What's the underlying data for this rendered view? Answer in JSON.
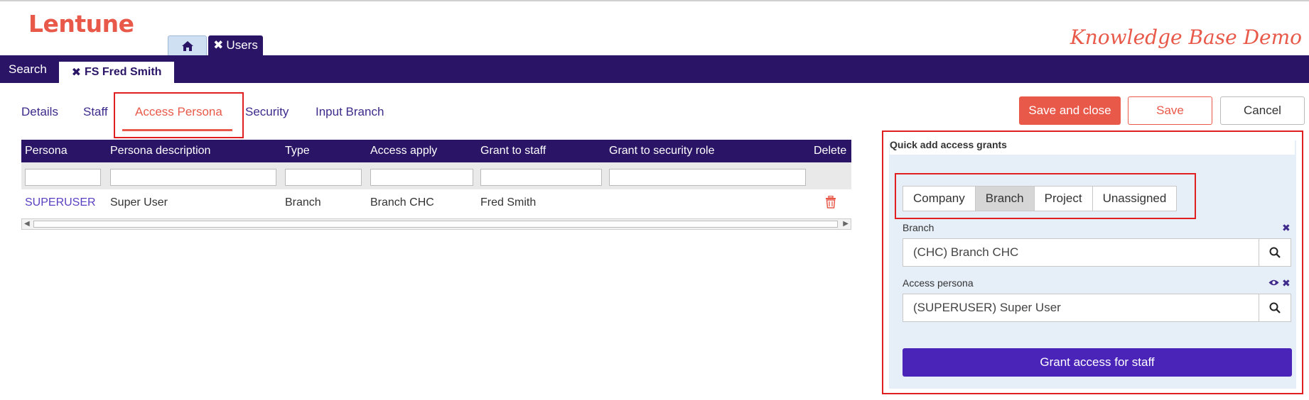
{
  "app": {
    "logo": "Lentune",
    "brand": "Knowledge Base Demo"
  },
  "app_tabs": {
    "home_icon": "home-icon",
    "users_label": "Users"
  },
  "navbar": {
    "search": "Search",
    "record": "FS Fred Smith"
  },
  "subtabs": [
    {
      "label": "Details"
    },
    {
      "label": "Staff"
    },
    {
      "label": "Access Persona",
      "active": true
    },
    {
      "label": "Security"
    },
    {
      "label": "Input Branch"
    }
  ],
  "actions": {
    "save_close": "Save and close",
    "save": "Save",
    "cancel": "Cancel"
  },
  "grid": {
    "columns": [
      "Persona",
      "Persona description",
      "Type",
      "Access apply",
      "Grant to staff",
      "Grant to security role",
      "Delete"
    ],
    "rows": [
      {
        "persona": "SUPERUSER",
        "description": "Super User",
        "type": "Branch",
        "access_apply": "Branch CHC",
        "grant_to_staff": "Fred Smith",
        "grant_to_role": ""
      }
    ]
  },
  "quick_add": {
    "title": "Quick add access grants",
    "segments": [
      "Company",
      "Branch",
      "Project",
      "Unassigned"
    ],
    "selected_segment": "Branch",
    "branch_label": "Branch",
    "branch_value": "(CHC) Branch CHC",
    "persona_label": "Access persona",
    "persona_value": "(SUPERUSER) Super User",
    "grant_button": "Grant access for staff"
  },
  "colors": {
    "accent": "#e8594a",
    "navy": "#2a1466",
    "primary": "#4a23b8"
  }
}
